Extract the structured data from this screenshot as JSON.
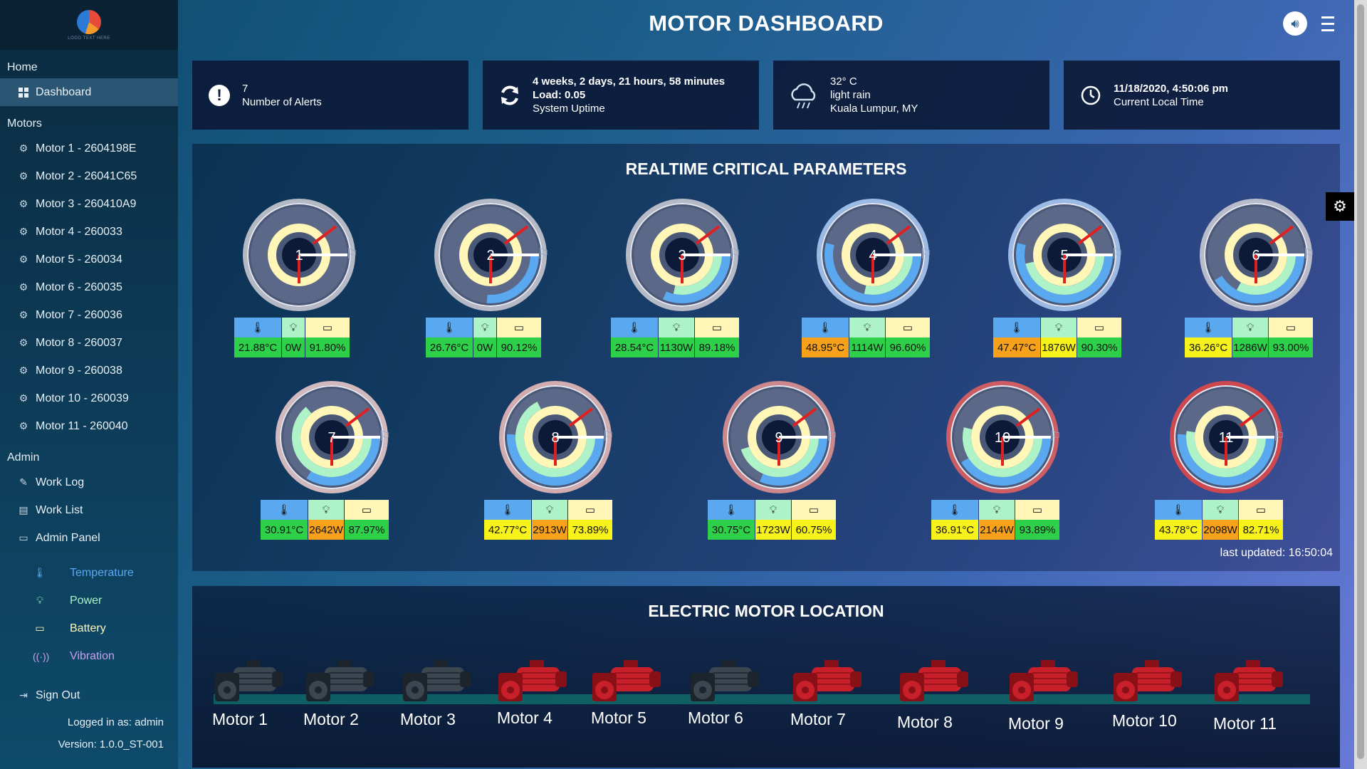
{
  "app": {
    "title": "MOTOR DASHBOARD",
    "logo_text": "LOGO TEXT HERE"
  },
  "sidebar": {
    "home_title": "Home",
    "dashboard_label": "Dashboard",
    "motors_title": "Motors",
    "motors": [
      "Motor 1 - 2604198E",
      "Motor 2 - 26041C65",
      "Motor 3 - 260410A9",
      "Motor 4 - 260033",
      "Motor 5 - 260034",
      "Motor 6 - 260035",
      "Motor 7 - 260036",
      "Motor 8 - 260037",
      "Motor 9 - 260038",
      "Motor 10 - 260039",
      "Motor 11 - 260040"
    ],
    "admin_title": "Admin",
    "admin_items": [
      "Work Log",
      "Work List",
      "Admin Panel"
    ],
    "legend": [
      {
        "label": "Temperature",
        "color": "#5aa8f0",
        "icon": "thermometer-icon"
      },
      {
        "label": "Power",
        "color": "#aef2c8",
        "icon": "bulb-icon"
      },
      {
        "label": "Battery",
        "color": "#fff6b8",
        "icon": "battery-icon"
      },
      {
        "label": "Vibration",
        "color": "#c8a0f0",
        "icon": "vibration-icon"
      }
    ],
    "sign_out": "Sign Out",
    "logged_in": "Logged in as: admin",
    "version": "Version: 1.0.0_ST-001"
  },
  "cards": {
    "alerts": {
      "count": "7",
      "label": "Number of Alerts"
    },
    "uptime": {
      "duration": "4 weeks, 2 days, 21 hours, 58 minutes",
      "load": "Load: 0.05",
      "label": "System Uptime"
    },
    "weather": {
      "temp": "32° C",
      "condition": "light rain",
      "location": "Kuala Lumpur, MY"
    },
    "time": {
      "datetime": "11/18/2020, 4:50:06 pm",
      "label": "Current Local Time"
    }
  },
  "realtime": {
    "title": "REALTIME CRITICAL PARAMETERS",
    "last_updated": "last updated: 16:50:04",
    "motors": [
      {
        "id": "1",
        "temp": "21.88°C",
        "power": "0W",
        "battery": "91.80%",
        "temp_c": "green",
        "pow_c": "green",
        "bat_c": "green",
        "t": 0.0,
        "p": 0.0,
        "b": 0.0,
        "ring": "#c8c8d0"
      },
      {
        "id": "2",
        "temp": "26.76°C",
        "power": "0W",
        "battery": "90.12%",
        "temp_c": "green",
        "pow_c": "green",
        "bat_c": "green",
        "t": 0.35,
        "p": 0.0,
        "b": 0.0,
        "ring": "#c8c8d0"
      },
      {
        "id": "3",
        "temp": "28.54°C",
        "power": "1130W",
        "battery": "89.18%",
        "temp_c": "green",
        "pow_c": "green",
        "bat_c": "green",
        "t": 0.42,
        "p": 0.38,
        "b": 0.0,
        "ring": "#c8c8d0"
      },
      {
        "id": "4",
        "temp": "48.95°C",
        "power": "1114W",
        "battery": "96.60%",
        "temp_c": "orange",
        "pow_c": "green",
        "bat_c": "green",
        "t": 0.72,
        "p": 0.38,
        "b": 0.0,
        "ring": "#aac8f0"
      },
      {
        "id": "5",
        "temp": "47.47°C",
        "power": "1876W",
        "battery": "90.30%",
        "temp_c": "orange",
        "pow_c": "yellow",
        "bat_c": "green",
        "t": 0.72,
        "p": 0.62,
        "b": 0.0,
        "ring": "#aac8f0"
      },
      {
        "id": "6",
        "temp": "36.26°C",
        "power": "1286W",
        "battery": "93.00%",
        "temp_c": "yellow",
        "pow_c": "green",
        "bat_c": "green",
        "t": 0.55,
        "p": 0.44,
        "b": 0.0,
        "ring": "#c8c8d0"
      },
      {
        "id": "7",
        "temp": "30.91°C",
        "power": "2642W",
        "battery": "87.97%",
        "temp_c": "green",
        "pow_c": "orange",
        "bat_c": "green",
        "t": 0.45,
        "p": 0.85,
        "b": 0.0,
        "ring": "#e8c8c8"
      },
      {
        "id": "8",
        "temp": "42.77°C",
        "power": "2913W",
        "battery": "73.89%",
        "temp_c": "yellow",
        "pow_c": "orange",
        "bat_c": "yellow",
        "t": 0.68,
        "p": 0.9,
        "b": 0.0,
        "ring": "#e8b8b8"
      },
      {
        "id": "9",
        "temp": "30.75°C",
        "power": "1723W",
        "battery": "60.75%",
        "temp_c": "green",
        "pow_c": "yellow",
        "bat_c": "yellow",
        "t": 0.42,
        "p": 0.6,
        "b": 0.0,
        "ring": "#e09090"
      },
      {
        "id": "10",
        "temp": "36.91°C",
        "power": "2144W",
        "battery": "93.89%",
        "temp_c": "yellow",
        "pow_c": "orange",
        "bat_c": "green",
        "t": 0.55,
        "p": 0.72,
        "b": 0.0,
        "ring": "#e06060"
      },
      {
        "id": "11",
        "temp": "43.78°C",
        "power": "2098W",
        "battery": "82.71%",
        "temp_c": "yellow",
        "pow_c": "orange",
        "bat_c": "yellow",
        "t": 0.68,
        "p": 0.7,
        "b": 0.0,
        "ring": "#e04848"
      }
    ]
  },
  "location": {
    "title": "ELECTRIC MOTOR LOCATION",
    "motors": [
      {
        "label": "Motor 1",
        "state": "off"
      },
      {
        "label": "Motor 2",
        "state": "off"
      },
      {
        "label": "Motor 3",
        "state": "off"
      },
      {
        "label": "Motor 4",
        "state": "on"
      },
      {
        "label": "Motor 5",
        "state": "on"
      },
      {
        "label": "Motor 6",
        "state": "off"
      },
      {
        "label": "Motor 7",
        "state": "on"
      },
      {
        "label": "Motor 8",
        "state": "on"
      },
      {
        "label": "Motor 9",
        "state": "on"
      },
      {
        "label": "Motor 10",
        "state": "on"
      },
      {
        "label": "Motor 11",
        "state": "on"
      }
    ]
  }
}
